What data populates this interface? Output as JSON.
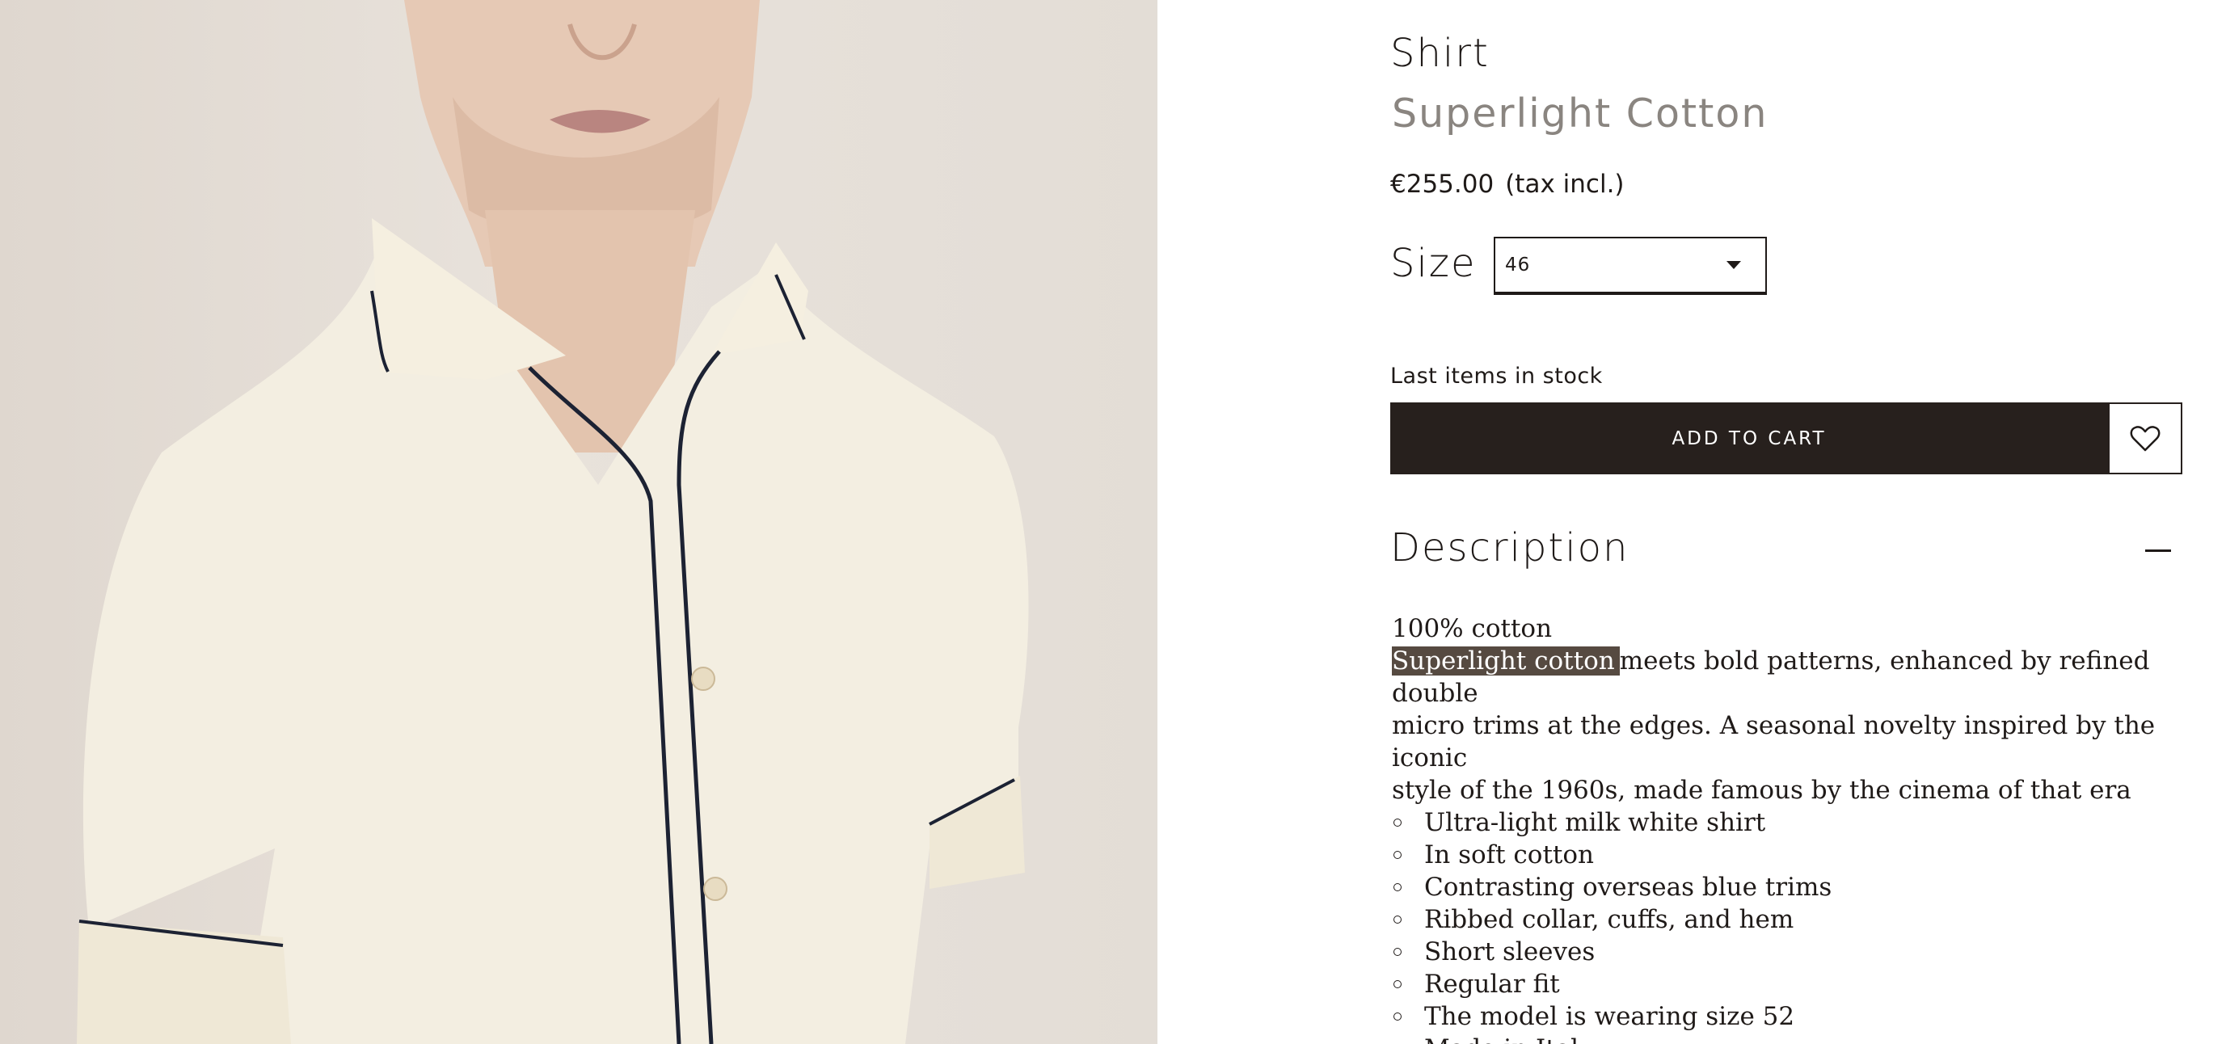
{
  "product": {
    "category": "Shirt",
    "name": "Superlight Cotton",
    "price": "€255.00",
    "tax_note": "(tax incl.)"
  },
  "size": {
    "label": "Size",
    "selected": "46"
  },
  "stock_note": "Last items in stock",
  "actions": {
    "add_to_cart": "ADD TO CART",
    "wishlist_icon": "heart-icon"
  },
  "description": {
    "title": "Description",
    "composition": "100% cotton",
    "highlight": "Superlight cotton",
    "text_line_1": "meets bold patterns, enhanced by refined double",
    "text_line_2": "micro trims at the edges. A seasonal novelty inspired by the iconic",
    "text_line_3": "style of the 1960s, made famous by the cinema of that era",
    "features": [
      "Ultra-light milk white shirt",
      "In soft cotton",
      "Contrasting overseas blue trims",
      "Ribbed collar, cuffs, and hem",
      "Short sleeves",
      "Regular fit",
      "The model is wearing size 52",
      "Made in Italy"
    ]
  },
  "colors": {
    "button_dark": "#27201d",
    "shirt": "#f3eee1",
    "trim": "#1c2233",
    "highlight_bg": "#564a41"
  }
}
